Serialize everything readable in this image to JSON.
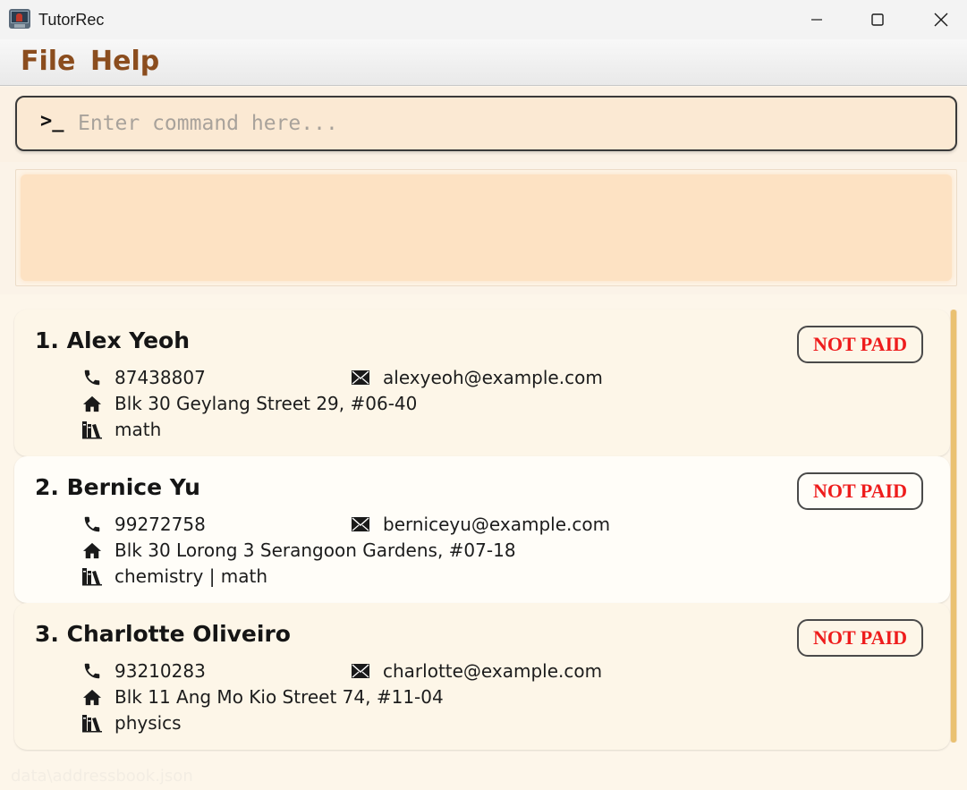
{
  "window": {
    "title": "TutorRec",
    "controls": [
      "minimize",
      "maximize",
      "close"
    ]
  },
  "menu": {
    "file": "File",
    "help": "Help"
  },
  "command": {
    "prompt": ">_",
    "placeholder": "Enter command here...",
    "value": ""
  },
  "result": {
    "text": ""
  },
  "persons": [
    {
      "index_name": "1. Alex Yeoh",
      "status": "NOT PAID",
      "phone": "87438807",
      "email": "alexyeoh@example.com",
      "address": "Blk 30 Geylang Street 29, #06-40",
      "subjects": "math"
    },
    {
      "index_name": "2. Bernice Yu",
      "status": "NOT PAID",
      "phone": "99272758",
      "email": "berniceyu@example.com",
      "address": "Blk 30 Lorong 3 Serangoon Gardens, #07-18",
      "subjects": "chemistry | math"
    },
    {
      "index_name": "3. Charlotte Oliveiro",
      "status": "NOT PAID",
      "phone": "93210283",
      "email": "charlotte@example.com",
      "address": "Blk 11 Ang Mo Kio Street 74, #11-04",
      "subjects": "physics"
    }
  ],
  "icons": {
    "phone": "phone-icon",
    "email": "envelope-icon",
    "address": "home-icon",
    "subjects": "books-icon"
  },
  "colors": {
    "menu_text": "#8b4d1e",
    "not_paid": "#ee1c1c",
    "result_bg": "#fde2c3",
    "scroll_thumb": "#eac171"
  },
  "status": {
    "path": "data\\addressbook.json"
  }
}
